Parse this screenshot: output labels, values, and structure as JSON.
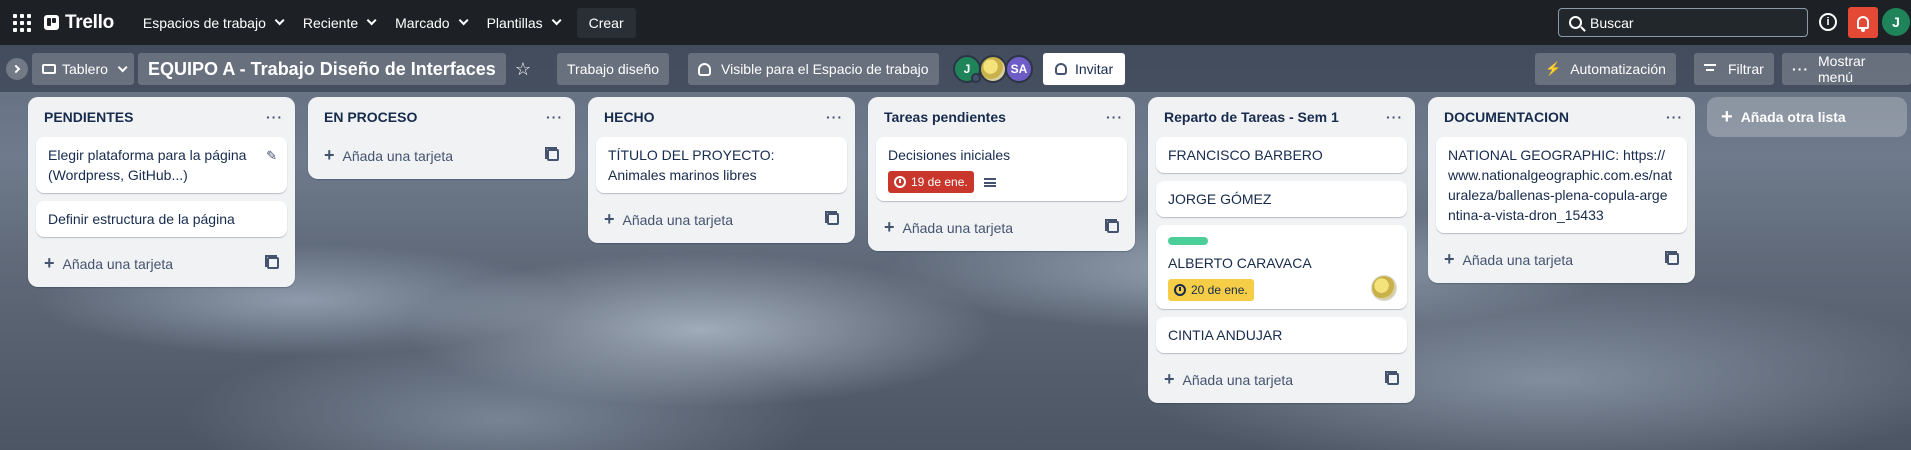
{
  "topbar": {
    "logo": "Trello",
    "menu": [
      {
        "label": "Espacios de trabajo"
      },
      {
        "label": "Reciente"
      },
      {
        "label": "Marcado"
      },
      {
        "label": "Plantillas"
      }
    ],
    "create": "Crear",
    "search_placeholder": "Buscar",
    "info_glyph": "i",
    "user_initial": "J"
  },
  "boardbar": {
    "view": "Tablero",
    "title": "EQUIPO A - Trabajo Diseño de Interfaces",
    "star": "☆",
    "team": "Trabajo diseño",
    "visibility": "Visible para el Espacio de trabajo",
    "members": [
      {
        "initials": "J",
        "color": "#1f845a"
      },
      {
        "initials": "",
        "color": "#d4c25a"
      },
      {
        "initials": "SA",
        "color": "#6e5dc6"
      }
    ],
    "invite": "Invitar",
    "automation": "Automatización",
    "filter": "Filtrar",
    "menu": "Mostrar menú"
  },
  "lists": [
    {
      "title": "PENDIENTES",
      "cards": [
        {
          "text": "Elegir plataforma para la página (Wordpress, GitHub...)"
        },
        {
          "text": "Definir estructura de la página"
        }
      ],
      "add": "Añada una tarjeta"
    },
    {
      "title": "EN PROCESO",
      "cards": [],
      "add": "Añada una tarjeta"
    },
    {
      "title": "HECHO",
      "cards": [
        {
          "text": "TÍTULO DEL PROYECTO: Animales marinos libres"
        }
      ],
      "add": "Añada una tarjeta"
    },
    {
      "title": "Tareas pendientes",
      "cards": [
        {
          "text": "Decisiones iniciales",
          "due": "19 de ene.",
          "due_color": "#c9372c"
        }
      ],
      "add": "Añada una tarjeta"
    },
    {
      "title": "Reparto de Tareas - Sem 1",
      "cards": [
        {
          "text": "FRANCISCO BARBERO"
        },
        {
          "text": "JORGE GÓMEZ"
        },
        {
          "text": "ALBERTO CARAVACA",
          "label_color": "#4bce97",
          "due": "20 de ene.",
          "due_color": "#f5cd47"
        },
        {
          "text": "CINTIA ANDUJAR"
        }
      ],
      "add": "Añada una tarjeta"
    },
    {
      "title": "DOCUMENTACION",
      "cards": [
        {
          "text": "NATIONAL GEOGRAPHIC: https://www.nationalgeographic.com.es/naturaleza/ballenas-plena-copula-argentina-a-vista-dron_15433"
        }
      ],
      "add": "Añada una tarjeta"
    }
  ],
  "add_list": "Añada otra lista"
}
